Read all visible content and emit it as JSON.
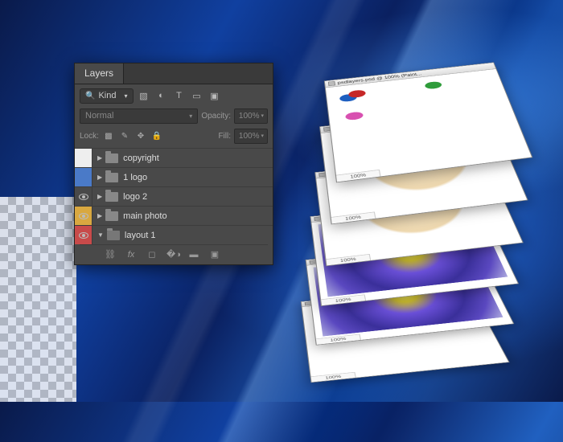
{
  "panel": {
    "tab_label": "Layers",
    "kind_label": "Kind",
    "blend_mode": "Normal",
    "opacity_label": "Opacity:",
    "opacity_value": "100%",
    "lock_label": "Lock:",
    "fill_label": "Fill:",
    "fill_value": "100%",
    "layers": [
      {
        "name": "copyright",
        "vis_color": "vis-white",
        "eye": false,
        "expanded": false
      },
      {
        "name": "1 logo",
        "vis_color": "vis-blue",
        "eye": false,
        "expanded": false
      },
      {
        "name": "logo 2",
        "vis_color": "vis-none",
        "eye": true,
        "expanded": false
      },
      {
        "name": "main photo",
        "vis_color": "vis-yellow",
        "eye": true,
        "expanded": false
      },
      {
        "name": "layout 1",
        "vis_color": "vis-red",
        "eye": true,
        "expanded": true
      }
    ]
  },
  "stack": {
    "title_prefix": "psdlayers.psd @ 100",
    "title_suffix": "(Paint...",
    "zoom_label": "100%",
    "windows": [
      {
        "content": "blank"
      },
      {
        "content": "flower"
      },
      {
        "content": "flower"
      },
      {
        "content": "face"
      },
      {
        "content": "face"
      },
      {
        "content": "bows"
      }
    ]
  }
}
